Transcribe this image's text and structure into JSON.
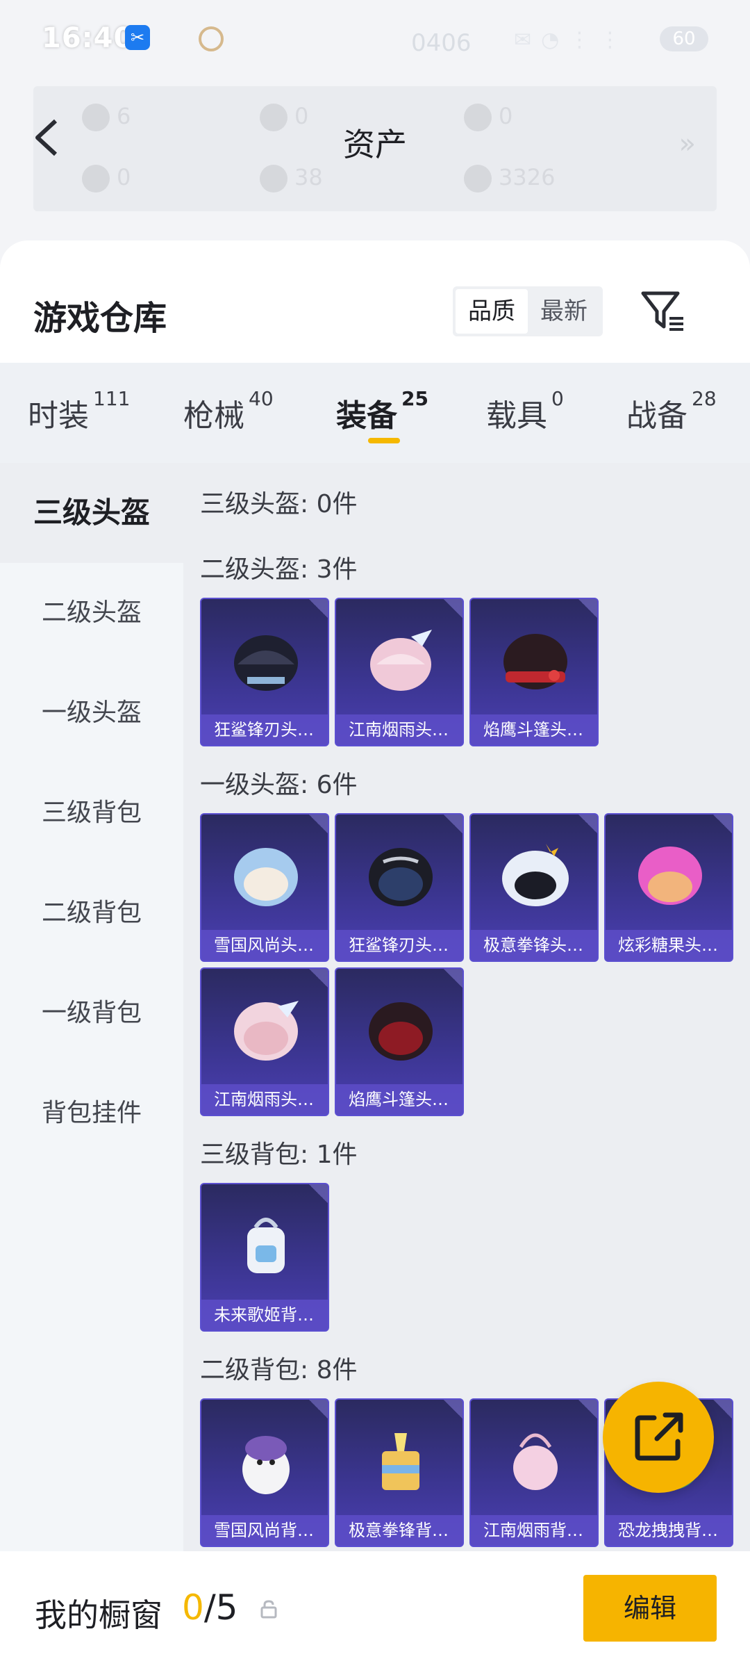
{
  "status_bar": {
    "time": "16:40",
    "center_value": "0406",
    "battery": "60"
  },
  "header": {
    "title": "资产",
    "assets_row1": [
      "6",
      "0",
      "0"
    ],
    "assets_row2": [
      "0",
      "38",
      "3326"
    ]
  },
  "panel": {
    "title": "游戏仓库",
    "sort_options": [
      "品质",
      "最新"
    ],
    "active_sort": "品质"
  },
  "tabs": [
    {
      "label": "时装",
      "count": "111"
    },
    {
      "label": "枪械",
      "count": "40"
    },
    {
      "label": "装备",
      "count": "25"
    },
    {
      "label": "载具",
      "count": "0"
    },
    {
      "label": "战备",
      "count": "28"
    }
  ],
  "active_tab": "装备",
  "sidebar": [
    "三级头盔",
    "二级头盔",
    "一级头盔",
    "三级背包",
    "二级背包",
    "一级背包",
    "背包挂件"
  ],
  "sections": [
    {
      "title": "三级头盔: 0件",
      "items": []
    },
    {
      "title": "二级头盔: 3件",
      "items": [
        "狂鲨锋刃头…",
        "江南烟雨头…",
        "焰鹰斗篷头…"
      ]
    },
    {
      "title": "一级头盔: 6件",
      "items": [
        "雪国风尚头…",
        "狂鲨锋刃头…",
        "极意拳锋头…",
        "炫彩糖果头…",
        "江南烟雨头…",
        "焰鹰斗篷头…"
      ]
    },
    {
      "title": "三级背包: 1件",
      "items": [
        "未来歌姬背…"
      ]
    },
    {
      "title": "二级背包: 8件",
      "items": [
        "雪国风尚背…",
        "极意拳锋背…",
        "江南烟雨背…",
        "恐龙拽拽背…"
      ]
    }
  ],
  "showcase": {
    "label": "我的橱窗",
    "current": "0",
    "total": "/5",
    "edit_label": "编辑"
  },
  "colors": {
    "accent": "#f6b400",
    "item_bg": "#3b3590",
    "item_label": "#5d4ec8"
  }
}
